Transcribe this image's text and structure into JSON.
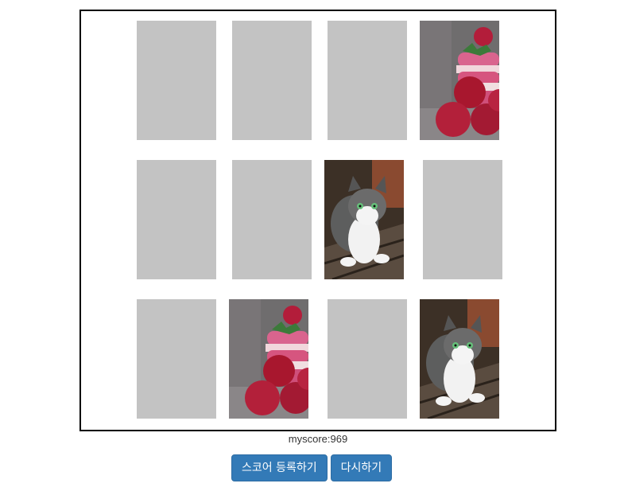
{
  "game": {
    "cards": [
      {
        "state": "down",
        "image": ""
      },
      {
        "state": "down",
        "image": ""
      },
      {
        "state": "down",
        "image": ""
      },
      {
        "state": "up",
        "image": "raspberry-macaron-photo"
      },
      {
        "state": "down",
        "image": ""
      },
      {
        "state": "down",
        "image": ""
      },
      {
        "state": "up",
        "image": "tabby-cat-photo"
      },
      {
        "state": "down",
        "image": ""
      },
      {
        "state": "down",
        "image": ""
      },
      {
        "state": "up",
        "image": "raspberry-macaron-photo"
      },
      {
        "state": "down",
        "image": ""
      },
      {
        "state": "up",
        "image": "tabby-cat-photo"
      }
    ],
    "card_back_color": "#c3c3c3"
  },
  "score": {
    "text": "myscore:969"
  },
  "buttons": {
    "submit_label": "스코어 등록하기",
    "restart_label": "다시하기",
    "color": "#337ab7"
  }
}
